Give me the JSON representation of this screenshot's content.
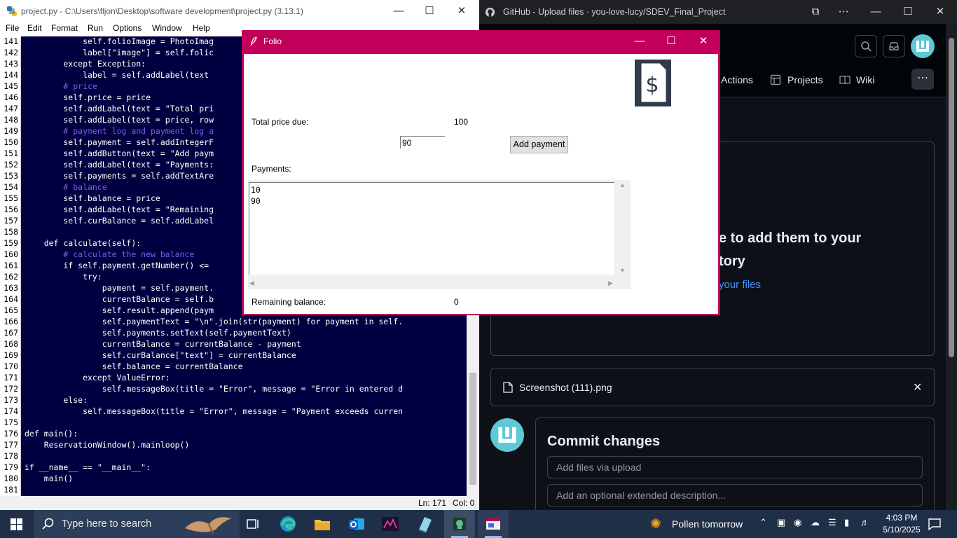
{
  "idle": {
    "title": "project.py - C:\\Users\\fljon\\Desktop\\software development\\project.py (3.13.1)",
    "menu": [
      "File",
      "Edit",
      "Format",
      "Run",
      "Options",
      "Window",
      "Help"
    ],
    "lines": [
      {
        "n": "141",
        "t": "            self.folioImage = PhotoImag"
      },
      {
        "n": "142",
        "t": "            label[\"image\"] = self.folic"
      },
      {
        "n": "143",
        "t": "        except Exception:"
      },
      {
        "n": "144",
        "t": "            label = self.addLabel(text"
      },
      {
        "n": "145",
        "t": "        # price"
      },
      {
        "n": "146",
        "t": "        self.price = price"
      },
      {
        "n": "147",
        "t": "        self.addLabel(text = \"Total pri"
      },
      {
        "n": "148",
        "t": "        self.addLabel(text = price, row"
      },
      {
        "n": "149",
        "t": "        # payment log and payment log a"
      },
      {
        "n": "150",
        "t": "        self.payment = self.addIntegerF"
      },
      {
        "n": "151",
        "t": "        self.addButton(text = \"Add paym"
      },
      {
        "n": "152",
        "t": "        self.addLabel(text = \"Payments:"
      },
      {
        "n": "153",
        "t": "        self.payments = self.addTextAre"
      },
      {
        "n": "154",
        "t": "        # balance"
      },
      {
        "n": "155",
        "t": "        self.balance = price"
      },
      {
        "n": "156",
        "t": "        self.addLabel(text = \"Remaining"
      },
      {
        "n": "157",
        "t": "        self.curBalance = self.addLabel"
      },
      {
        "n": "158",
        "t": ""
      },
      {
        "n": "159",
        "t": "    def calculate(self):"
      },
      {
        "n": "160",
        "t": "        # calculate the new balance"
      },
      {
        "n": "161",
        "t": "        if self.payment.getNumber() <="
      },
      {
        "n": "162",
        "t": "            try:"
      },
      {
        "n": "163",
        "t": "                payment = self.payment."
      },
      {
        "n": "164",
        "t": "                currentBalance = self.b"
      },
      {
        "n": "165",
        "t": "                self.result.append(paym"
      },
      {
        "n": "166",
        "t": "                self.paymentText = \"\\n\".join(str(payment) for payment in self."
      },
      {
        "n": "167",
        "t": "                self.payments.setText(self.paymentText)"
      },
      {
        "n": "168",
        "t": "                currentBalance = currentBalance - payment"
      },
      {
        "n": "169",
        "t": "                self.curBalance[\"text\"] = currentBalance"
      },
      {
        "n": "170",
        "t": "                self.balance = currentBalance"
      },
      {
        "n": "171",
        "t": "            except ValueError:"
      },
      {
        "n": "172",
        "t": "                self.messageBox(title = \"Error\", message = \"Error in entered d"
      },
      {
        "n": "173",
        "t": "        else:"
      },
      {
        "n": "174",
        "t": "            self.messageBox(title = \"Error\", message = \"Payment exceeds curren"
      },
      {
        "n": "175",
        "t": ""
      },
      {
        "n": "176",
        "t": "def main():"
      },
      {
        "n": "177",
        "t": "    ReservationWindow().mainloop()"
      },
      {
        "n": "178",
        "t": ""
      },
      {
        "n": "179",
        "t": "if __name__ == \"__main__\":"
      },
      {
        "n": "180",
        "t": "    main()"
      },
      {
        "n": "181",
        "t": ""
      }
    ],
    "status_ln": "Ln: 171",
    "status_col": "Col: 0"
  },
  "github": {
    "title": "GitHub - Upload files · you-love-lucy/SDEV_Final_Project",
    "nav": [
      "Actions",
      "Projects",
      "Wiki"
    ],
    "drop_line1": "e to add them to your",
    "drop_line2": "tory",
    "drop_link": "your files",
    "file_name": "Screenshot (111).png",
    "commit_title": "Commit changes",
    "commit_placeholder": "Add files via upload",
    "description_placeholder": "Add an optional extended description..."
  },
  "folio": {
    "title": "Folio",
    "total_label": "Total price due:",
    "total_value": "100",
    "payment_input": "90",
    "add_button": "Add payment",
    "payments_label": "Payments:",
    "payments_text": "10\n90",
    "remaining_label": "Remaining balance:",
    "remaining_value": "0",
    "icon": "dollar-document-icon"
  },
  "taskbar": {
    "search_placeholder": "Type here to search",
    "weather": "Pollen tomorrow",
    "time": "4:03 PM",
    "date": "5/10/2025"
  },
  "colors": {
    "folio_accent": "#c2005a",
    "idle_bg": "#000040",
    "github_bg": "#0d1117",
    "github_link": "#4493f8"
  }
}
